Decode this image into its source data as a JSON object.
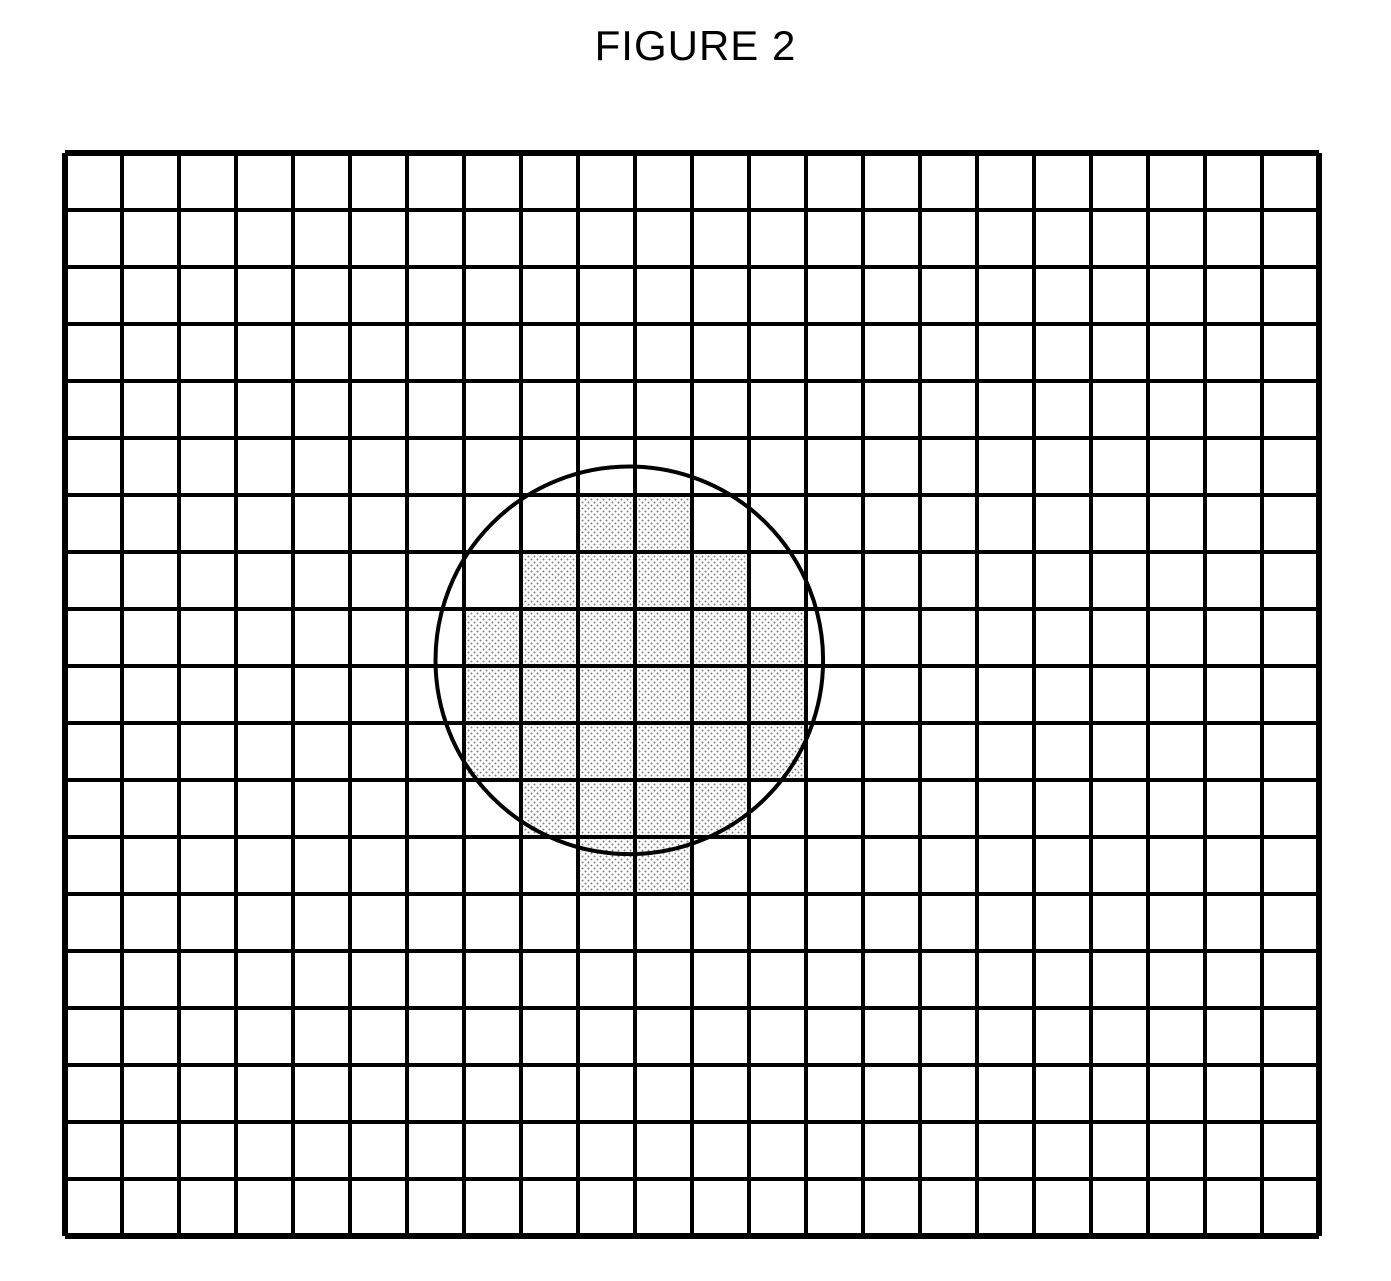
{
  "title": "FIGURE 2",
  "grid": {
    "cols": 22,
    "rows": 19,
    "cell": 57,
    "stroke": "#000000",
    "stroke_width": 4,
    "outer_stroke_width": 6
  },
  "circle": {
    "cx_cells": 9.9,
    "cy_cells": 8.9,
    "r_cells": 3.4,
    "stroke": "#000000",
    "stroke_width": 4,
    "fill": "none"
  },
  "shaded_cells": [
    [
      9,
      6
    ],
    [
      10,
      6
    ],
    [
      8,
      7
    ],
    [
      9,
      7
    ],
    [
      10,
      7
    ],
    [
      11,
      7
    ],
    [
      7,
      8
    ],
    [
      8,
      8
    ],
    [
      9,
      8
    ],
    [
      10,
      8
    ],
    [
      11,
      8
    ],
    [
      12,
      8
    ],
    [
      7,
      9
    ],
    [
      8,
      9
    ],
    [
      9,
      9
    ],
    [
      10,
      9
    ],
    [
      11,
      9
    ],
    [
      12,
      9
    ],
    [
      7,
      10
    ],
    [
      8,
      10
    ],
    [
      9,
      10
    ],
    [
      10,
      10
    ],
    [
      11,
      10
    ],
    [
      12,
      10
    ],
    [
      8,
      11
    ],
    [
      9,
      11
    ],
    [
      10,
      11
    ],
    [
      11,
      11
    ],
    [
      9,
      12
    ],
    [
      10,
      12
    ]
  ],
  "shade_pattern": {
    "dot_color": "#808080",
    "bg": "#ffffff"
  }
}
